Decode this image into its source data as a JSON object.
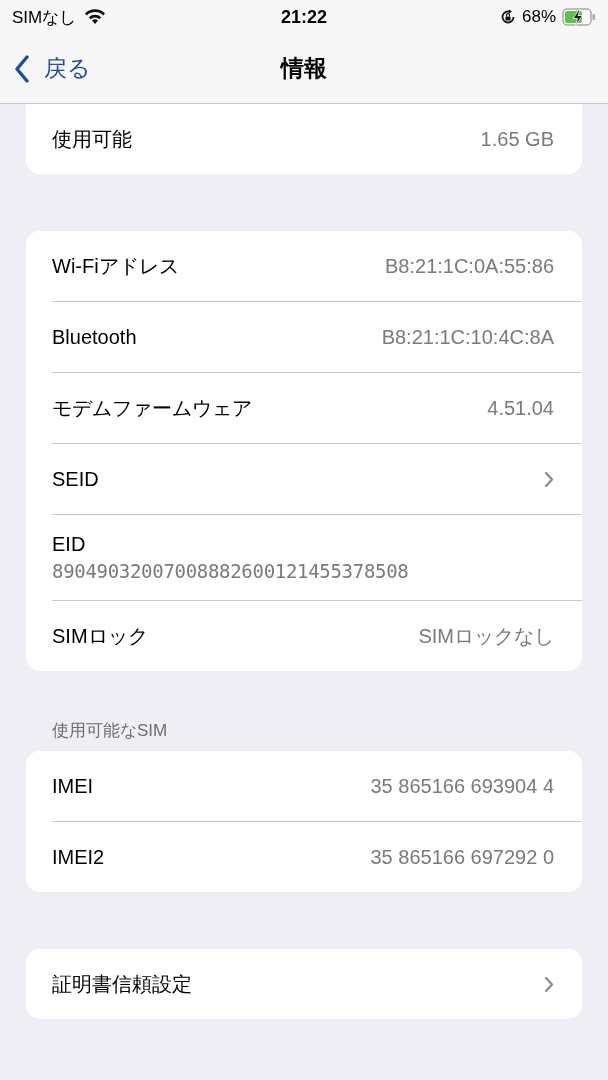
{
  "status_bar": {
    "carrier": "SIMなし",
    "time": "21:22",
    "battery_percent": "68%"
  },
  "nav": {
    "back": "戻る",
    "title": "情報"
  },
  "groups": [
    {
      "rows": [
        {
          "kind": "value",
          "label": "使用可能",
          "value": "1.65 GB"
        }
      ]
    },
    {
      "rows": [
        {
          "kind": "value",
          "label": "Wi-Fiアドレス",
          "value": "B8:21:1C:0A:55:86"
        },
        {
          "kind": "value",
          "label": "Bluetooth",
          "value": "B8:21:1C:10:4C:8A"
        },
        {
          "kind": "value",
          "label": "モデムファームウェア",
          "value": "4.51.04"
        },
        {
          "kind": "chevron",
          "label": "SEID"
        },
        {
          "kind": "stacked",
          "label": "EID",
          "value": "89049032007008882600121455378508"
        },
        {
          "kind": "value",
          "label": "SIMロック",
          "value": "SIMロックなし"
        }
      ]
    },
    {
      "header": "使用可能なSIM",
      "rows": [
        {
          "kind": "value",
          "label": "IMEI",
          "value": "35 865166 693904 4"
        },
        {
          "kind": "value",
          "label": "IMEI2",
          "value": "35 865166 697292 0"
        }
      ]
    },
    {
      "rows": [
        {
          "kind": "chevron",
          "label": "証明書信頼設定"
        }
      ]
    }
  ]
}
